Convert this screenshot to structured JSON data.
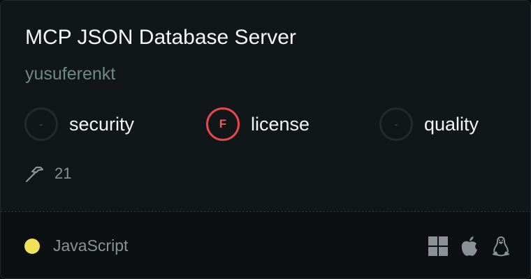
{
  "server": {
    "name": "MCP JSON Database Server",
    "owner": "yusuferenkt"
  },
  "scores": [
    {
      "grade": "-",
      "label": "security",
      "status": "none"
    },
    {
      "grade": "F",
      "label": "license",
      "status": "fail"
    },
    {
      "grade": "-",
      "label": "quality",
      "status": "none"
    }
  ],
  "tools": {
    "icon": "hammer-icon",
    "count": "21"
  },
  "footer": {
    "language": "JavaScript",
    "language_color": "#f1e05a",
    "platforms": [
      "windows-icon",
      "apple-icon",
      "linux-icon"
    ]
  },
  "colors": {
    "fail": "#e5484d",
    "owner": "#6e8a82"
  }
}
